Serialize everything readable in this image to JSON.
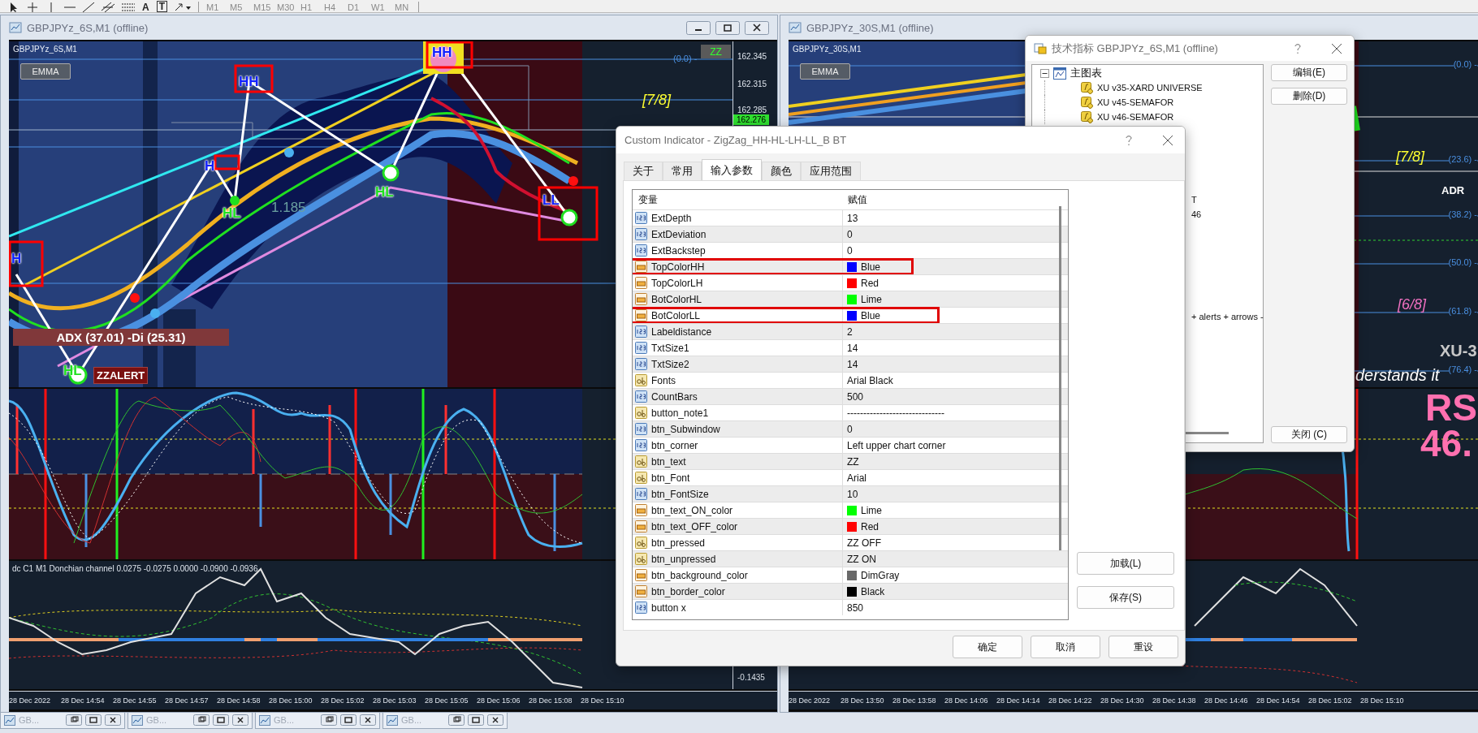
{
  "toolbar": {
    "text_tools": [
      "A",
      "T"
    ],
    "timeframes": [
      "M1",
      "M5",
      "M15",
      "M30",
      "H1",
      "H4",
      "D1",
      "W1",
      "MN"
    ]
  },
  "left_chart": {
    "window_title": "GBPJPYz_6S,M1 (offline)",
    "symbol": "GBPJPYz_6S,M1",
    "emma_button": "EMMA",
    "zz_button": "ZZ",
    "fibo_label": "(0.0) -",
    "murrey_label": "[7/8]",
    "zigzag_labels": [
      {
        "text": "HH",
        "kind": "top"
      },
      {
        "text": "HH",
        "kind": "top"
      },
      {
        "text": "H",
        "kind": "top"
      },
      {
        "text": "HL",
        "kind": "bottom"
      },
      {
        "text": "HL",
        "kind": "bottom"
      },
      {
        "text": "H",
        "kind": "top"
      },
      {
        "text": "HL",
        "kind": "bottom"
      },
      {
        "text": "LL",
        "kind": "top"
      }
    ],
    "value_label": "1.185",
    "adx_label": "ADX (37.01)  -Di (25.31)",
    "alert_label": "ZZALERT",
    "price_ticks": [
      "162.345",
      "162.315",
      "162.285"
    ],
    "current_price": "162.276",
    "donchian_label": "dc C1 M1 Donchian channel 0.0275 -0.0275 0.0000 -0.0900 -0.0936",
    "sub_tick": "-0.1435",
    "time_labels": [
      "28 Dec 2022",
      "28 Dec 14:54",
      "28 Dec 14:55",
      "28 Dec 14:57",
      "28 Dec 14:58",
      "28 Dec 15:00",
      "28 Dec 15:02",
      "28 Dec 15:03",
      "28 Dec 15:05",
      "28 Dec 15:06",
      "28 Dec 15:08",
      "28 Dec 15:10"
    ]
  },
  "right_chart": {
    "window_title": "GBPJPYz_30S,M1 (offline)",
    "symbol": "GBPJPYz_30S,M1",
    "emma_button": "EMMA",
    "fibo_levels": [
      "(0.0) -",
      "(23.6) -",
      "(38.2) -",
      "(50.0) -",
      "(61.8) -",
      "(76.4) -"
    ],
    "murrey_labels": [
      "[7/8]",
      "[6/8]"
    ],
    "adr_label": "ADR",
    "xu_label": "XU-3",
    "caption": "derstands it",
    "rsi_label": "RS",
    "rsi_value": "46.",
    "time_labels": [
      "28 Dec 2022",
      "28 Dec 13:50",
      "28 Dec 13:58",
      "28 Dec 14:06",
      "28 Dec 14:14",
      "28 Dec 14:22",
      "28 Dec 14:30",
      "28 Dec 14:38",
      "28 Dec 14:46",
      "28 Dec 14:54",
      "28 Dec 15:02",
      "28 Dec 15:10"
    ]
  },
  "indicators_dialog": {
    "title": "技术指标 GBPJPYz_6S,M1 (offline)",
    "tree": {
      "label": "主图表",
      "expanded": true,
      "children": [
        {
          "label": "XU v35-XARD UNIVERSE"
        },
        {
          "label": "XU v45-SEMAFOR"
        },
        {
          "label": "XU v46-SEMAFOR"
        }
      ]
    },
    "fragments": [
      "T",
      "46",
      "+ alerts + arrows -"
    ],
    "buttons": [
      "编辑(E)",
      "删除(D)"
    ],
    "close_button": "关闭 (C)"
  },
  "dialog": {
    "title": "Custom Indicator - ZigZag_HH-HL-LH-LL_B BT",
    "tabs": [
      {
        "label": "关于",
        "selected": false
      },
      {
        "label": "常用",
        "selected": false
      },
      {
        "label": "输入参数",
        "selected": true
      },
      {
        "label": "颜色",
        "selected": false
      },
      {
        "label": "应用范围",
        "selected": false
      }
    ],
    "columns": [
      "变量",
      "赋值"
    ],
    "rows": [
      {
        "name": "ExtDepth",
        "kind": "int",
        "value": "13",
        "highlighted": false
      },
      {
        "name": "ExtDeviation",
        "kind": "int",
        "value": "0",
        "highlighted": false
      },
      {
        "name": "ExtBackstep",
        "kind": "int",
        "value": "0",
        "highlighted": false
      },
      {
        "name": "TopColorHH",
        "kind": "color",
        "value": "Blue",
        "color": "#0000ff",
        "highlighted": true
      },
      {
        "name": "TopColorLH",
        "kind": "color",
        "value": "Red",
        "color": "#ff0000",
        "highlighted": false
      },
      {
        "name": "BotColorHL",
        "kind": "color",
        "value": "Lime",
        "color": "#00ff00",
        "highlighted": false
      },
      {
        "name": "BotColorLL",
        "kind": "color",
        "value": "Blue",
        "color": "#0000ff",
        "highlighted": true
      },
      {
        "name": "Labeldistance",
        "kind": "int",
        "value": "2",
        "highlighted": false
      },
      {
        "name": "TxtSize1",
        "kind": "int",
        "value": "14",
        "highlighted": false
      },
      {
        "name": "TxtSize2",
        "kind": "int",
        "value": "14",
        "highlighted": false
      },
      {
        "name": "Fonts",
        "kind": "string",
        "value": "Arial Black",
        "highlighted": false
      },
      {
        "name": "CountBars",
        "kind": "int",
        "value": "500",
        "highlighted": false
      },
      {
        "name": "button_note1",
        "kind": "string",
        "value": "------------------------------",
        "highlighted": false
      },
      {
        "name": "btn_Subwindow",
        "kind": "int",
        "value": "0",
        "highlighted": false
      },
      {
        "name": "btn_corner",
        "kind": "int",
        "value": "Left upper chart corner",
        "highlighted": false
      },
      {
        "name": "btn_text",
        "kind": "string",
        "value": "ZZ",
        "highlighted": false
      },
      {
        "name": "btn_Font",
        "kind": "string",
        "value": "Arial",
        "highlighted": false
      },
      {
        "name": "btn_FontSize",
        "kind": "int",
        "value": "10",
        "highlighted": false
      },
      {
        "name": "btn_text_ON_color",
        "kind": "color",
        "value": "Lime",
        "color": "#00ff00",
        "highlighted": false
      },
      {
        "name": "btn_text_OFF_color",
        "kind": "color",
        "value": "Red",
        "color": "#ff0000",
        "highlighted": false
      },
      {
        "name": "btn_pressed",
        "kind": "string",
        "value": "ZZ OFF",
        "highlighted": false
      },
      {
        "name": "btn_unpressed",
        "kind": "string",
        "value": "ZZ ON",
        "highlighted": false
      },
      {
        "name": "btn_background_color",
        "kind": "color",
        "value": "DimGray",
        "color": "#696969",
        "highlighted": false
      },
      {
        "name": "btn_border_color",
        "kind": "color",
        "value": "Black",
        "color": "#000000",
        "highlighted": false
      },
      {
        "name": "button x",
        "kind": "int",
        "value": "850",
        "highlighted": false
      }
    ],
    "side_buttons": [
      "加载(L)",
      "保存(S)"
    ],
    "footer_buttons": [
      "确定",
      "取消",
      "重设"
    ]
  },
  "taskbar": [
    {
      "label": "GB..."
    },
    {
      "label": "GB..."
    },
    {
      "label": "GB..."
    },
    {
      "label": "GB..."
    }
  ]
}
